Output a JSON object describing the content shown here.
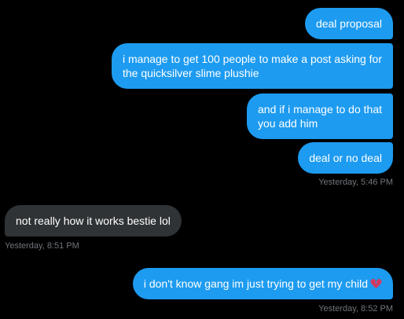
{
  "messages": [
    {
      "sender": "me",
      "lines": [
        "deal proposal"
      ]
    },
    {
      "sender": "me",
      "lines": [
        "i manage to get 100 people to make a post asking for",
        "the quicksilver slime plushie"
      ]
    },
    {
      "sender": "me",
      "lines": [
        "and if i manage to do that",
        "you add him"
      ]
    },
    {
      "sender": "me",
      "lines": [
        "deal or no deal"
      ]
    },
    {
      "sender": "them",
      "lines": [
        "not really how it works bestie lol"
      ]
    },
    {
      "sender": "me",
      "lines": [
        "i don't know gang im just trying to get my child"
      ],
      "emoji": "broken-heart-icon"
    }
  ],
  "timestamps": {
    "first_group": "Yesterday, 5:46 PM",
    "reply": "Yesterday, 8:51 PM",
    "last": "Yesterday, 8:52 PM"
  },
  "colors": {
    "background": "#000000",
    "outgoing_bubble": "#1d9bf0",
    "incoming_bubble": "#2f3336",
    "timestamp": "#71767b",
    "broken_heart": "#d3385f"
  }
}
